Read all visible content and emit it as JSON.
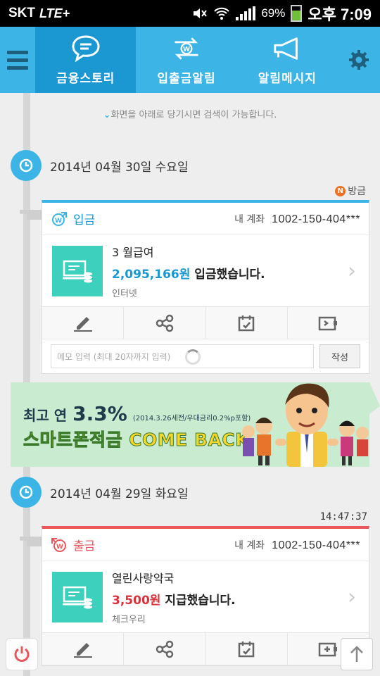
{
  "status_bar": {
    "carrier": "SKT",
    "network": "LTE+",
    "battery": "69%",
    "time": "오후 7:09"
  },
  "nav": {
    "tabs": [
      {
        "label": "금융스토리",
        "icon": "speech-bubble-icon",
        "active": true
      },
      {
        "label": "입출금알림",
        "icon": "won-exchange-icon",
        "active": false
      },
      {
        "label": "알림메시지",
        "icon": "megaphone-icon",
        "active": false
      }
    ]
  },
  "pull_hint": "화면을 아래로 당기시면 검색이 가능합니다.",
  "days": [
    {
      "date": "2014년 04월 30일 수요일"
    },
    {
      "date": "2014년 04월 29일 화요일"
    }
  ],
  "source_tag": "방금",
  "source_badge": "N",
  "time_label": "14:47:37",
  "cards": [
    {
      "type_label": "입금",
      "account_label": "내 계좌",
      "account_number": "1002-150-404***",
      "title": "3 월급여",
      "amount": "2,095,166원",
      "action_text": " 입금했습니다.",
      "sub": "인터넷",
      "memo_placeholder": "메모 입력 (최대 20자까지 입력)",
      "memo_button": "작성"
    },
    {
      "type_label": "출금",
      "account_label": "내 계좌",
      "account_number": "1002-150-404***",
      "title": "열린사랑약국",
      "amount": "3,500원",
      "action_text": " 지급했습니다.",
      "sub": "체크우리"
    }
  ],
  "banner": {
    "prefix": "최고 연",
    "rate": "3.3%",
    "note": "(2014.3.26세전/우대금리0.2%p포함)",
    "headline": "스마트폰적금 COME BACK"
  },
  "colors": {
    "primary": "#3cb5e6",
    "primary_dark": "#1b98d2",
    "withdraw": "#e9575d",
    "teal": "#3dd1bd",
    "banner_bg": "#c9ecd1"
  }
}
